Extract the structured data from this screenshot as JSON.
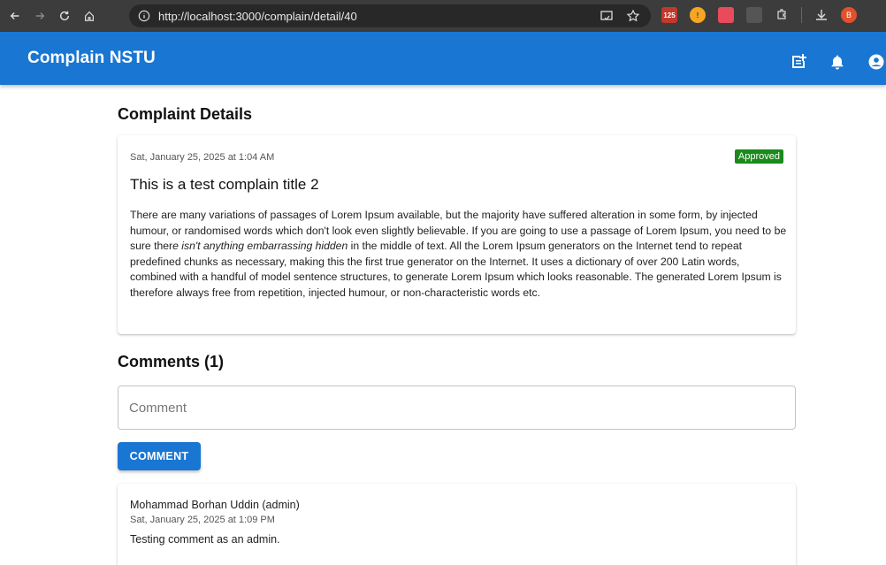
{
  "browser": {
    "url": "http://localhost:3000/complain/detail/40",
    "extension_badge": "125",
    "profile_initial": "B"
  },
  "app": {
    "title": "Complain NSTU",
    "icons": [
      "note-add-icon",
      "bell-icon",
      "account-circle-icon"
    ]
  },
  "details": {
    "heading": "Complaint Details",
    "date": "Sat, January 25, 2025 at 1:04 AM",
    "status": "Approved",
    "status_color": "#1a8a1a",
    "title": "This is a test complain title 2",
    "body_part1": "There are many variations of passages of Lorem Ipsum available, but the majority have suffered alteration in some form, by injected humour, or randomised words which don't look even slightly believable. If you are going to use a passage of Lorem Ipsum, you need to be sure ther",
    "body_italic": "e isn't anything embarrassing hidden",
    "body_part2": " in the middle of text. All the Lorem Ipsum generators on the Internet tend to repeat predefined chunks as necessary, making this the first true generator on the Internet. It uses a dictionary of over 200 Latin words, combined with a handful of model sentence structures, to generate Lorem Ipsum which looks reasonable. The generated Lorem Ipsum is therefore always free from repetition, injected humour, or non-characteristic words etc."
  },
  "comments": {
    "heading": "Comments (1)",
    "input_placeholder": "Comment",
    "input_value": "",
    "button_label": "COMMENT",
    "items": [
      {
        "author": "Mohammad Borhan Uddin (admin)",
        "date": "Sat, January 25, 2025 at 1:09 PM",
        "text": "Testing comment as an admin."
      }
    ]
  },
  "colors": {
    "primary": "#1976d2",
    "browser_bar": "#3c3c3c"
  }
}
